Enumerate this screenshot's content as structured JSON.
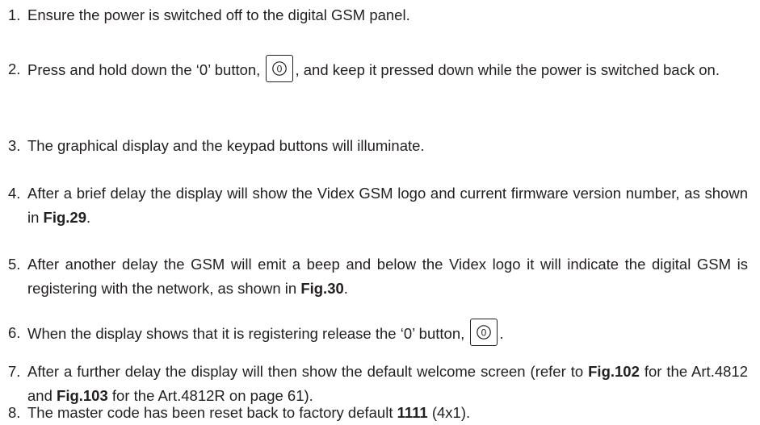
{
  "steps": [
    {
      "num": "1.",
      "text": "Ensure the power is switched off to the digital GSM panel."
    },
    {
      "num": "2.",
      "text_before": "Press and hold down the ‘0’ button,",
      "key_icon": "zero-key-icon",
      "text_after": ", and keep it pressed down while the power is switched back on."
    },
    {
      "num": "3.",
      "text": "The graphical display and the keypad buttons will illuminate."
    },
    {
      "num": "4.",
      "text_before": "After a brief delay the display will show the Videx GSM logo and current firmware version number, as shown in ",
      "fig": "Fig.29",
      "text_after": "."
    },
    {
      "num": "5.",
      "text_before": "After another delay the GSM will emit a beep and below the Videx logo it will indicate the digital GSM is registering with the network, as shown in ",
      "fig": "Fig.30",
      "text_after": "."
    },
    {
      "num": "6.",
      "text_before": "When the display shows that it is registering release the ‘0’ button,",
      "key_icon": "zero-key-icon",
      "text_after": "."
    },
    {
      "num": "7.",
      "text_a": "After a further delay the display will then show the default welcome screen (refer to ",
      "fig_a": "Fig.102",
      "text_b": " for the Art.4812 and ",
      "fig_b": "Fig.103",
      "text_c": " for the Art.4812R on page 61)."
    },
    {
      "num": "8.",
      "text_before": "The master code has been reset back to factory default ",
      "code": "1111",
      "text_after": " (4x1)."
    }
  ]
}
